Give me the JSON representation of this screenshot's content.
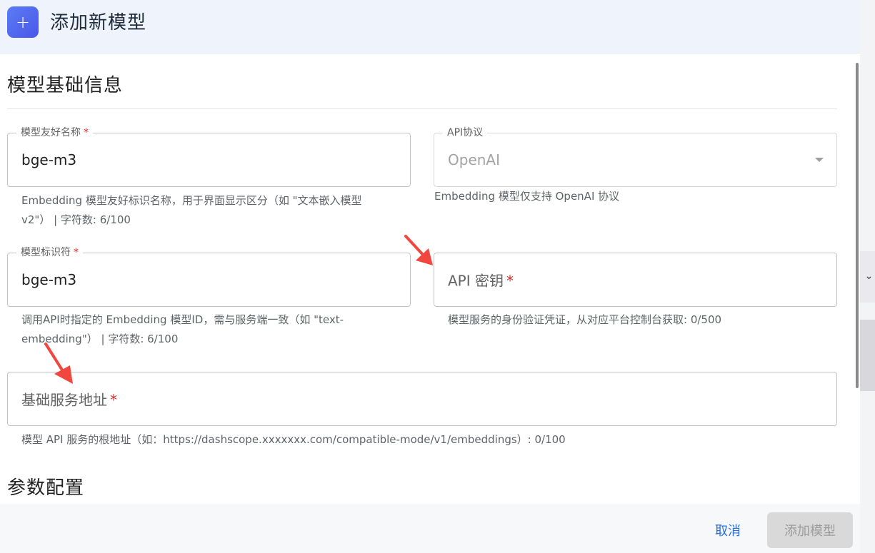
{
  "header": {
    "icon": "plus-icon",
    "title": "添加新模型"
  },
  "sections": {
    "basic": "模型基础信息",
    "params": "参数配置"
  },
  "fields": {
    "friendly_name": {
      "label": "模型友好名称",
      "required": "*",
      "value": "bge-m3",
      "helper_line1": "Embedding 模型友好标识名称，用于界面显示区分（如 \"文本嵌入模型",
      "helper_line2": "v2\"） | 字符数: 6/100"
    },
    "api_protocol": {
      "label": "API协议",
      "value": "OpenAI",
      "helper": "Embedding 模型仅支持 OpenAI 协议"
    },
    "model_id": {
      "label": "模型标识符",
      "required": "*",
      "value": "bge-m3",
      "helper_line1": "调用API时指定的 Embedding 模型ID，需与服务端一致（如 \"text-",
      "helper_line2": "embedding\"） | 字符数: 6/100"
    },
    "api_key": {
      "placeholder": "API 密钥",
      "required": "*",
      "helper": "模型服务的身份验证凭证，从对应平台控制台获取: 0/500"
    },
    "base_url": {
      "placeholder": "基础服务地址",
      "required": "*",
      "helper": "模型 API 服务的根地址（如：https://dashscope.xxxxxxx.com/compatible-mode/v1/embeddings）: 0/100"
    }
  },
  "footer": {
    "cancel_label": "取消",
    "submit_label": "添加模型"
  },
  "colors": {
    "accent": "#2a6fdb",
    "required": "#d32f2f",
    "annotation_arrow": "#f2473f"
  }
}
